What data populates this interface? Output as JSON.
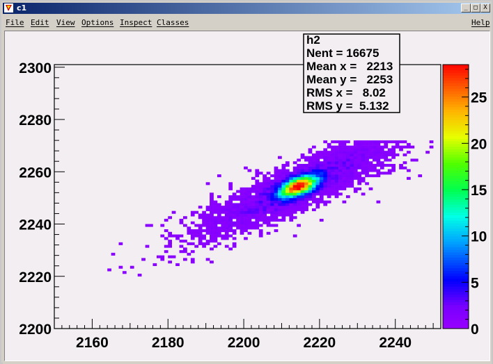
{
  "window": {
    "title": "c1",
    "buttons": [
      "_",
      "□",
      "X"
    ]
  },
  "menu": {
    "items": [
      "File",
      "Edit",
      "View",
      "Options",
      "Inspect",
      "Classes"
    ],
    "help": "Help"
  },
  "stats": {
    "name": "h2",
    "lines": [
      "Nent = 16675",
      "Mean x =   2213",
      "Mean y =   2253",
      "RMS x =   8.02",
      "RMS y =  5.132"
    ]
  },
  "colors": {
    "frame_bg": "#f2eef2",
    "titlebar_left": "#0a246a",
    "titlebar_right": "#a6caf0"
  },
  "chart_data": {
    "type": "heatmap",
    "x_ticks": [
      2160,
      2180,
      2200,
      2220,
      2240
    ],
    "y_ticks": [
      2200,
      2220,
      2240,
      2260,
      2280,
      2300
    ],
    "xlim": [
      2150,
      2252
    ],
    "ylim": [
      2200,
      2301
    ],
    "z_ticks": [
      0,
      5,
      10,
      15,
      20,
      25
    ],
    "zlim": [
      0,
      28.5
    ],
    "peak": {
      "x": 2214,
      "y": 2254,
      "z": 28
    },
    "distribution": {
      "mean_x": 2213,
      "mean_y": 2253,
      "rms_x": 8.02,
      "rms_y": 5.132
    }
  }
}
